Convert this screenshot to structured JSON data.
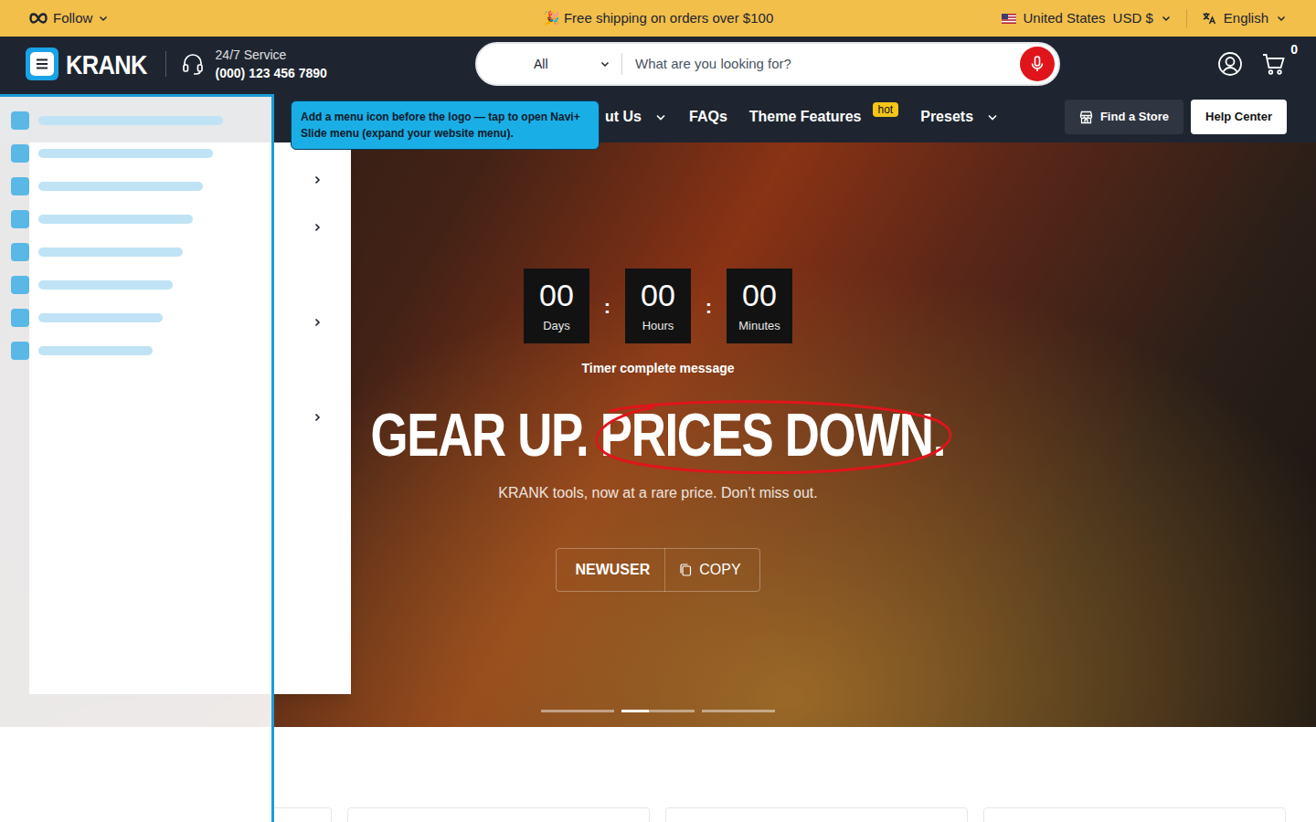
{
  "announcement": {
    "follow": "Follow",
    "message": "🎉 Free shipping on orders over $100",
    "country": "United States",
    "currency": "USD $",
    "language": "English"
  },
  "header": {
    "logo": "KRANK",
    "service_title": "24/7 Service",
    "phone": "(000) 123 456 7890",
    "search": {
      "category": "All",
      "placeholder": "What are you looking for?"
    },
    "cart_count": "0"
  },
  "nav": {
    "items": [
      {
        "label": "ut Us",
        "has_dropdown": true
      },
      {
        "label": "FAQs",
        "has_dropdown": false
      },
      {
        "label": "Theme Features",
        "has_dropdown": false,
        "badge": "hot"
      },
      {
        "label": "Presets",
        "has_dropdown": true
      }
    ],
    "buttons": [
      "Find a Store",
      "Help Center"
    ]
  },
  "tooltip": "Add a menu icon before the logo — tap to open Navi+ Slide menu (expand your website menu).",
  "menu_panel": {
    "rows": [
      {
        "has_submenu": true
      },
      {
        "has_submenu": true
      },
      {
        "has_submenu": false
      },
      {
        "has_submenu": true
      },
      {
        "has_submenu": false
      },
      {
        "has_submenu": true
      },
      {
        "has_submenu": false
      },
      {
        "has_submenu": false
      },
      {
        "has_submenu": false
      },
      {
        "has_submenu": false
      },
      {
        "has_submenu": false
      }
    ]
  },
  "hero": {
    "countdown": [
      {
        "value": "00",
        "unit": "Days"
      },
      {
        "value": "00",
        "unit": "Hours"
      },
      {
        "value": "00",
        "unit": "Minutes"
      }
    ],
    "separator": ":",
    "timer_message": "Timer complete message",
    "headline": {
      "plain": "GEAR UP.",
      "circled": "PRICES DOWN."
    },
    "subtitle": "KRANK tools, now at a rare price. Don’t miss out.",
    "coupon": {
      "code": "NEWUSER",
      "action": "COPY"
    },
    "slides": [
      {
        "selected": false,
        "level": 0
      },
      {
        "selected": true,
        "level": 0.38
      },
      {
        "selected": false,
        "level": 0
      }
    ]
  }
}
